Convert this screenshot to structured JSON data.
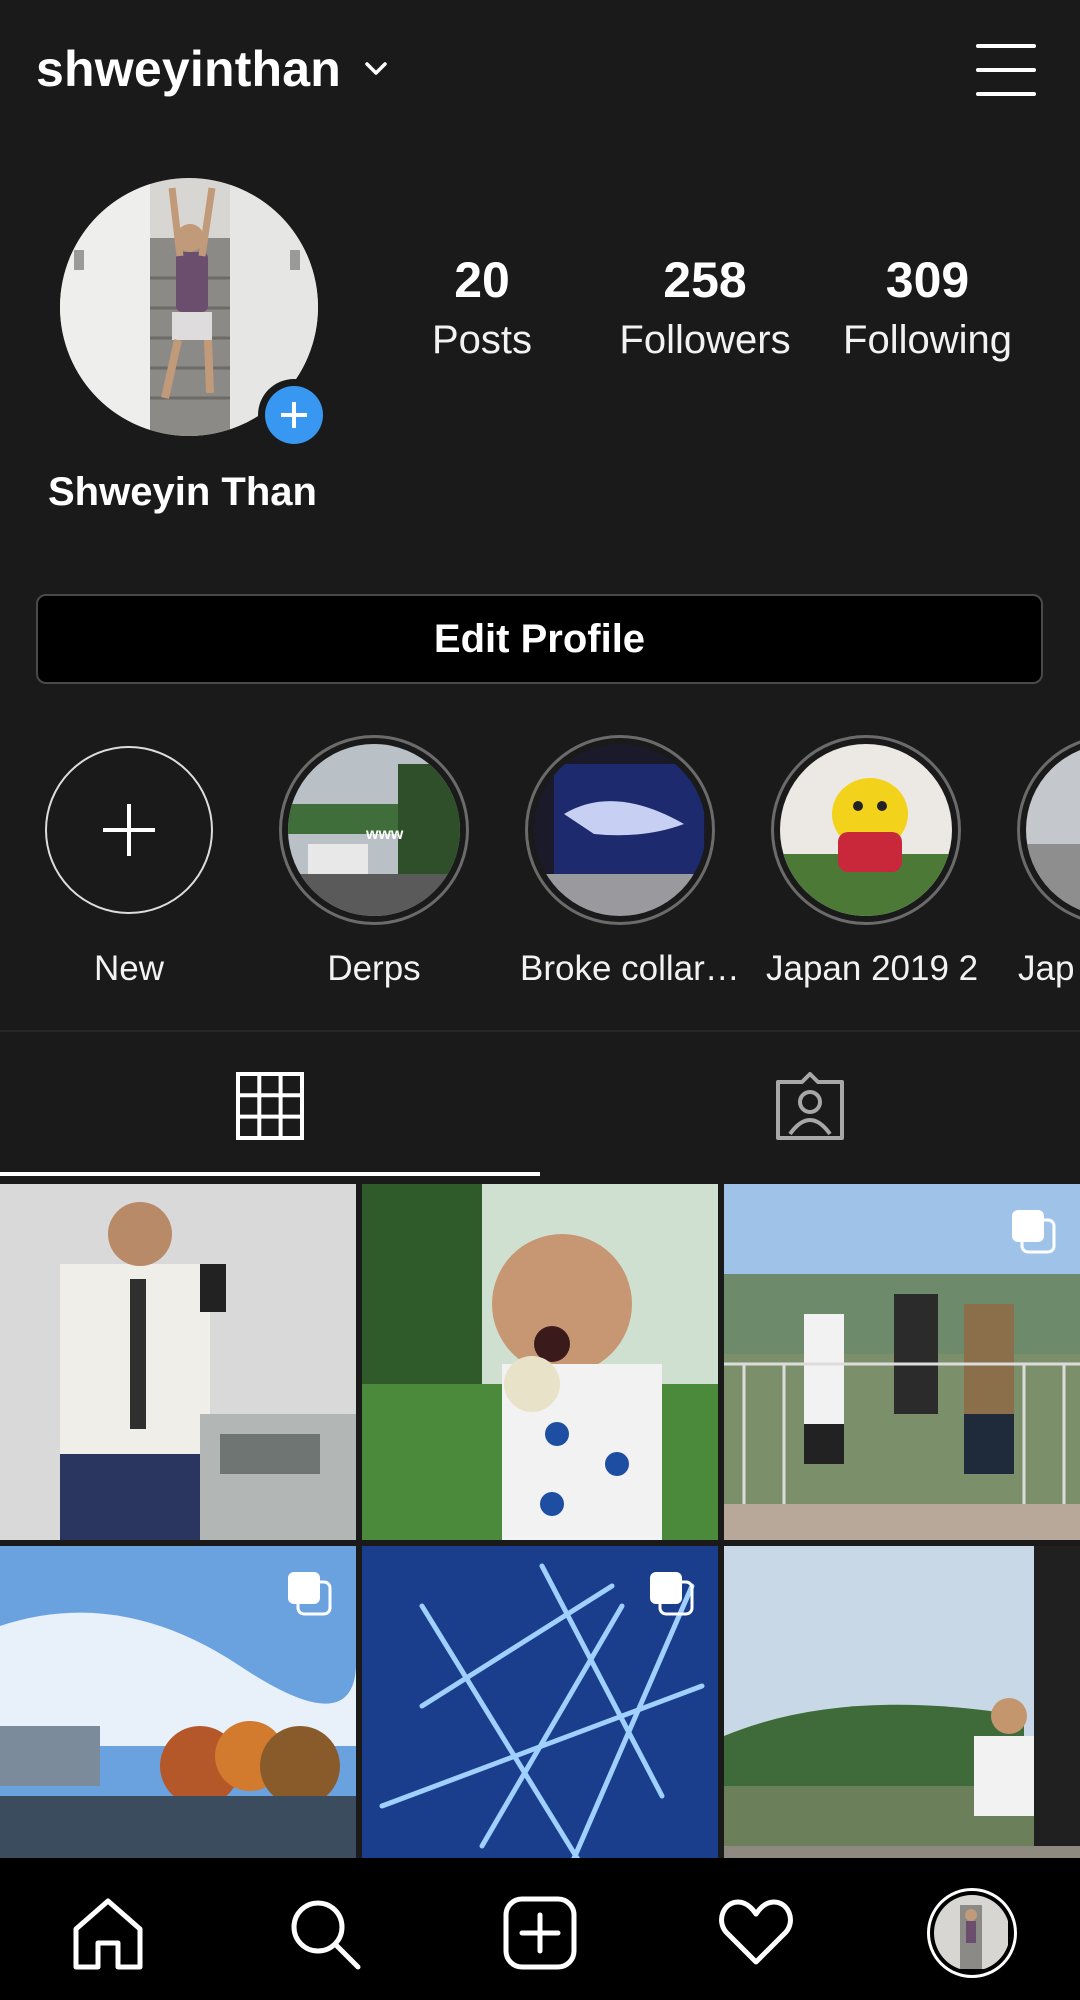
{
  "header": {
    "username": "shweyinthan",
    "icons": {
      "dropdown": "chevron-down-icon",
      "menu": "hamburger-menu-icon"
    }
  },
  "profile": {
    "display_name": "Shweyin Than",
    "avatar_icon": "profile-photo",
    "add_story_icon": "plus-icon",
    "stats": {
      "posts": {
        "count": "20",
        "label": "Posts"
      },
      "followers": {
        "count": "258",
        "label": "Followers"
      },
      "following": {
        "count": "309",
        "label": "Following"
      }
    },
    "edit_button": "Edit Profile"
  },
  "highlights": [
    {
      "label": "New"
    },
    {
      "label": "Derps"
    },
    {
      "label": "Broke collar…"
    },
    {
      "label": "Japan 2019 2"
    },
    {
      "label": "Jap"
    }
  ],
  "tabs": {
    "grid_icon": "grid-icon",
    "tagged_icon": "tagged-person-icon",
    "active": "grid"
  },
  "bottom_nav": {
    "icons": [
      "home-icon",
      "search-icon",
      "add-post-icon",
      "heart-icon",
      "profile-avatar"
    ]
  },
  "colors": {
    "background": "#1a1a1a",
    "accent": "#3897f0",
    "nav_bg": "#000000"
  }
}
